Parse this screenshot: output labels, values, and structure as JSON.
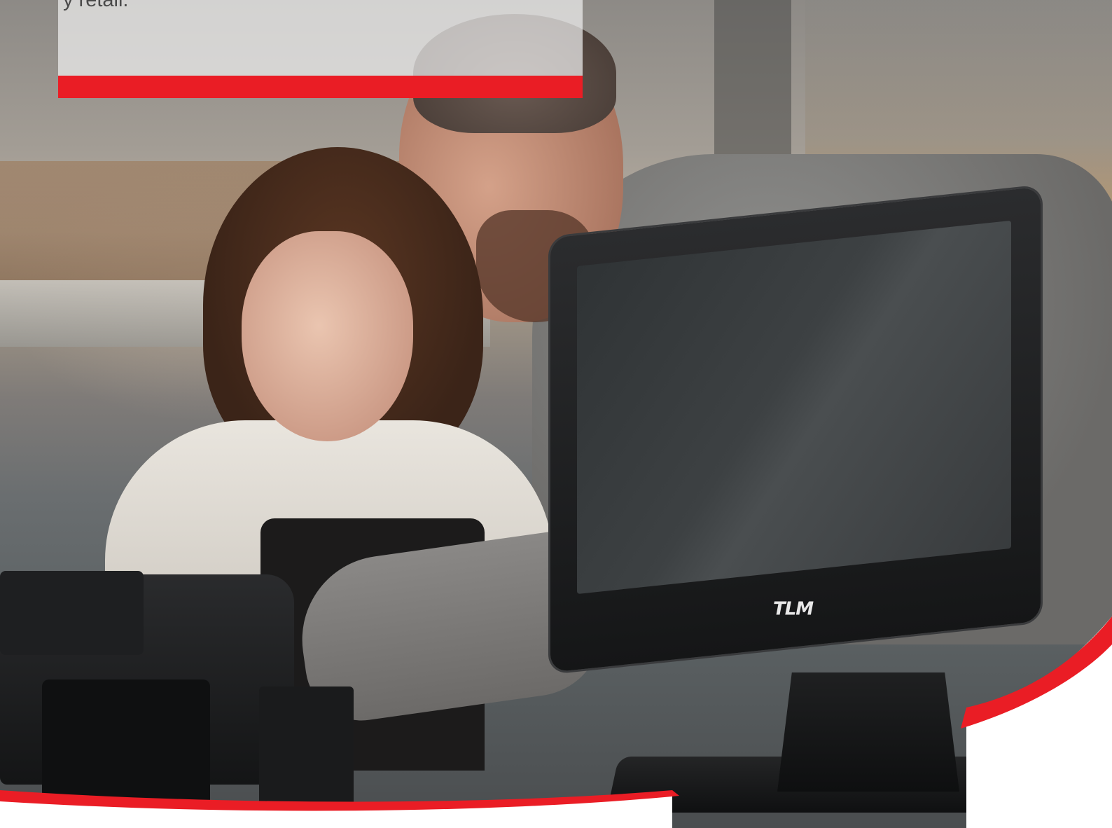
{
  "card": {
    "text": "y retail."
  },
  "monitor": {
    "logo_text": "TLM"
  },
  "colors": {
    "accent_red": "#ea1d25",
    "card_background": "#eeeeee",
    "monitor_black": "#151617"
  }
}
